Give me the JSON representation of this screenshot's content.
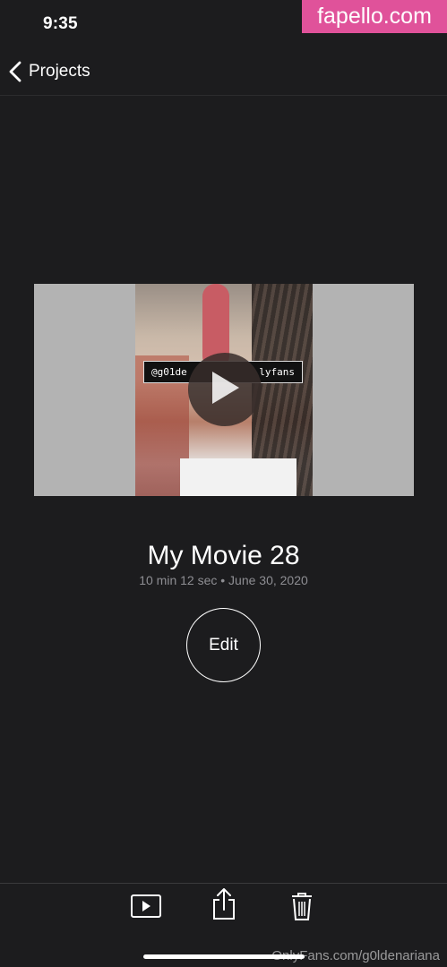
{
  "status_bar": {
    "time": "9:35"
  },
  "watermark": {
    "text": "fapello.com"
  },
  "nav": {
    "back_label": "Projects"
  },
  "video": {
    "overlay_left": "@g01de",
    "overlay_right": "lyfans"
  },
  "project": {
    "title": "My Movie 28",
    "meta": "10 min 12 sec • June 30, 2020",
    "edit_label": "Edit"
  },
  "toolbar": {
    "icons": [
      "play-icon",
      "share-icon",
      "trash-icon"
    ]
  },
  "credit": {
    "text": "OnlyFans.com/g0ldenariana"
  }
}
